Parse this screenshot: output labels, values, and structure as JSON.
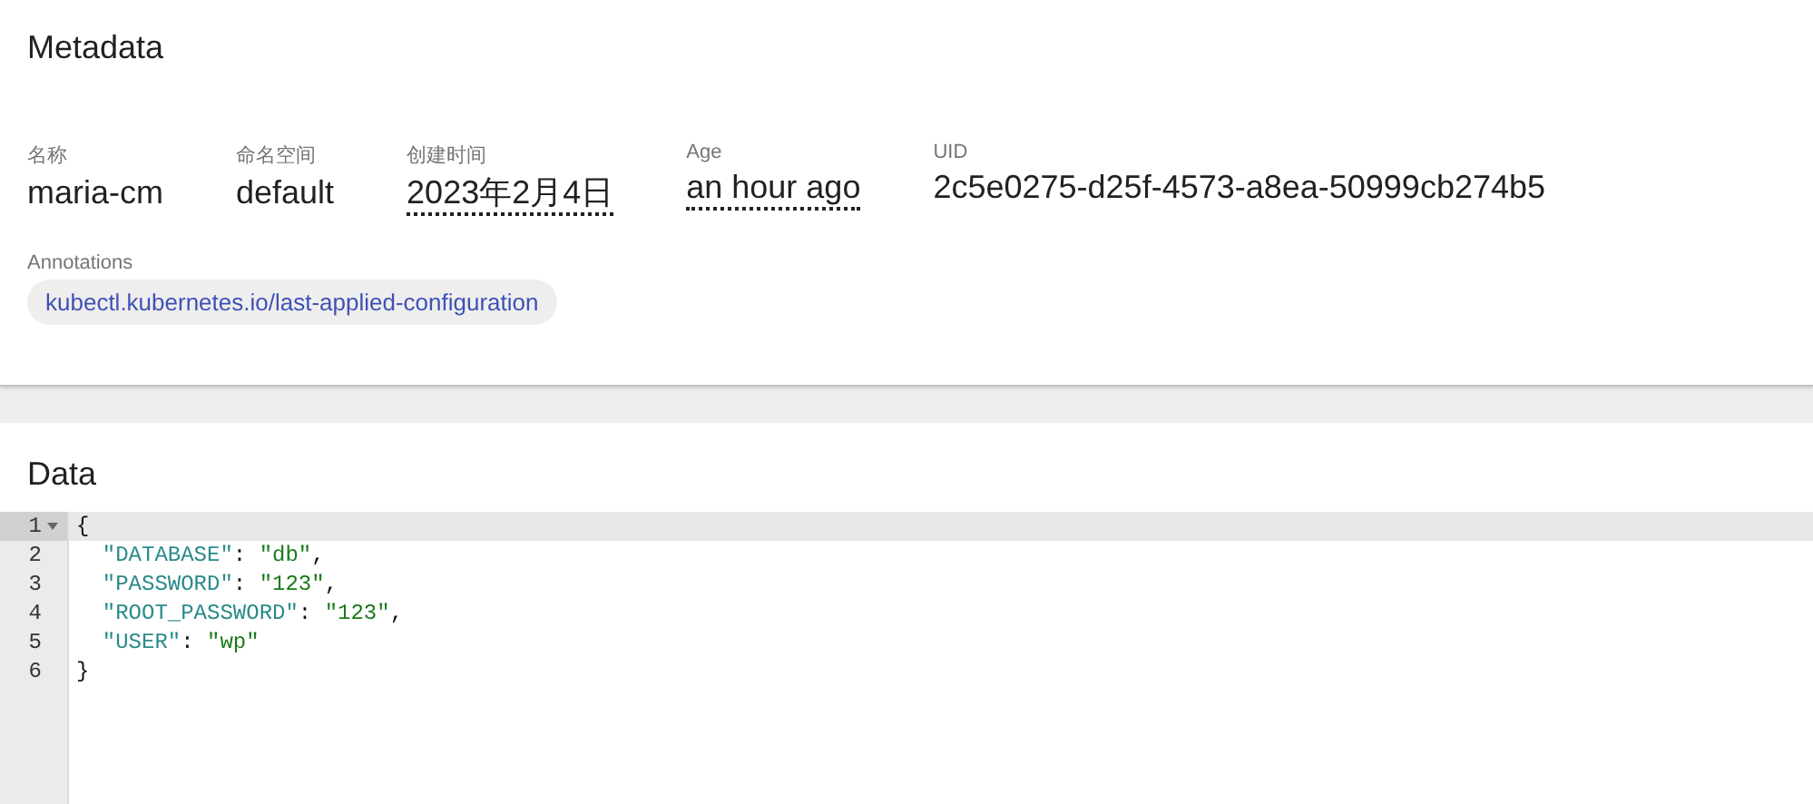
{
  "metadata": {
    "title": "Metadata",
    "fields": [
      {
        "label": "名称",
        "value": "maria-cm",
        "kind": "plain"
      },
      {
        "label": "命名空间",
        "value": "default",
        "kind": "plain"
      },
      {
        "label": "创建时间",
        "value": "2023年2月4日",
        "kind": "tooltip"
      },
      {
        "label": "Age",
        "value": "an hour ago",
        "kind": "tooltip"
      },
      {
        "label": "UID",
        "value": "2c5e0275-d25f-4573-a8ea-50999cb274b5",
        "kind": "plain"
      }
    ],
    "annotations": {
      "label": "Annotations",
      "chips": [
        "kubectl.kubernetes.io/last-applied-configuration"
      ]
    }
  },
  "data": {
    "title": "Data",
    "lines": [
      {
        "number": "1",
        "active": true,
        "foldable": true,
        "tokens": [
          {
            "kind": "punct",
            "text": "{"
          }
        ]
      },
      {
        "number": "2",
        "active": false,
        "foldable": false,
        "tokens": [
          {
            "kind": "key",
            "text": "  \"DATABASE\""
          },
          {
            "kind": "punct",
            "text": ": "
          },
          {
            "kind": "string",
            "text": "\"db\""
          },
          {
            "kind": "punct",
            "text": ","
          }
        ]
      },
      {
        "number": "3",
        "active": false,
        "foldable": false,
        "tokens": [
          {
            "kind": "key",
            "text": "  \"PASSWORD\""
          },
          {
            "kind": "punct",
            "text": ": "
          },
          {
            "kind": "string",
            "text": "\"123\""
          },
          {
            "kind": "punct",
            "text": ","
          }
        ]
      },
      {
        "number": "4",
        "active": false,
        "foldable": false,
        "tokens": [
          {
            "kind": "key",
            "text": "  \"ROOT_PASSWORD\""
          },
          {
            "kind": "punct",
            "text": ": "
          },
          {
            "kind": "string",
            "text": "\"123\""
          },
          {
            "kind": "punct",
            "text": ","
          }
        ]
      },
      {
        "number": "5",
        "active": false,
        "foldable": false,
        "tokens": [
          {
            "kind": "key",
            "text": "  \"USER\""
          },
          {
            "kind": "punct",
            "text": ": "
          },
          {
            "kind": "string",
            "text": "\"wp\""
          }
        ]
      },
      {
        "number": "6",
        "active": false,
        "foldable": false,
        "tokens": [
          {
            "kind": "punct",
            "text": "}"
          }
        ]
      }
    ]
  }
}
